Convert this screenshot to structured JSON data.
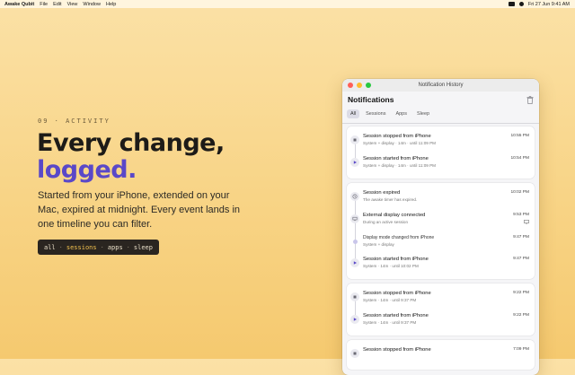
{
  "menubar": {
    "app_name": "Awake Qubit",
    "menus": [
      "File",
      "Edit",
      "View",
      "Window",
      "Help"
    ],
    "clock": "Fri 27 Jun  9:41 AM"
  },
  "hero": {
    "eyebrow": "09 · ACTIVITY",
    "headline_line1": "Every change,",
    "headline_line2": "logged.",
    "lede": "Started from your iPhone, extended on your Mac, expired at midnight. Every event lands in one timeline you can filter.",
    "filter_pill": {
      "items": [
        "all",
        "sessions",
        "apps",
        "sleep"
      ],
      "separator": "·",
      "active_index": 1
    }
  },
  "colors": {
    "accent": "#5a48c8",
    "highlight": "#f2c14e",
    "background_top": "#fbe1a6",
    "background_bottom": "#f5c96f"
  },
  "window": {
    "title": "Notification History",
    "header": "Notifications",
    "tabs": [
      {
        "label": "All",
        "active": true
      },
      {
        "label": "Sessions",
        "active": false
      },
      {
        "label": "Apps",
        "active": false
      },
      {
        "label": "Sleep",
        "active": false
      }
    ],
    "groups": [
      {
        "rows": [
          {
            "icon": "stop-icon",
            "title": "Session stopped from iPhone",
            "sub": "System + display · 14m · until 11:09 PM",
            "time": "10:55 PM"
          },
          {
            "icon": "play-icon",
            "title": "Session started from iPhone",
            "sub": "System + display · 14m · until 11:09 PM",
            "time": "10:54 PM"
          }
        ]
      },
      {
        "rows": [
          {
            "icon": "clock-icon",
            "title": "Session expired",
            "sub": "The awake timer has expired.",
            "time": "10:02 PM"
          },
          {
            "icon": "display-icon",
            "title": "External display connected",
            "sub": "During an active session",
            "time": "9:53 PM",
            "badge_icon": "monitor-icon"
          },
          {
            "icon": "dot-icon",
            "title": "Display mode changed from iPhone",
            "sub": "System + display",
            "time": "9:47 PM",
            "small": true
          },
          {
            "icon": "play-icon",
            "title": "Session started from iPhone",
            "sub": "System · 14m · until 10:02 PM",
            "time": "9:47 PM"
          }
        ]
      },
      {
        "rows": [
          {
            "icon": "stop-icon",
            "title": "Session stopped from iPhone",
            "sub": "System · 14m · until 9:37 PM",
            "time": "9:22 PM"
          },
          {
            "icon": "play-icon",
            "title": "Session started from iPhone",
            "sub": "System · 14m · until 9:37 PM",
            "time": "9:22 PM"
          }
        ]
      },
      {
        "rows": [
          {
            "icon": "stop-icon",
            "title": "Session stopped from iPhone",
            "sub": "",
            "time": "7:09 PM"
          }
        ]
      }
    ]
  }
}
